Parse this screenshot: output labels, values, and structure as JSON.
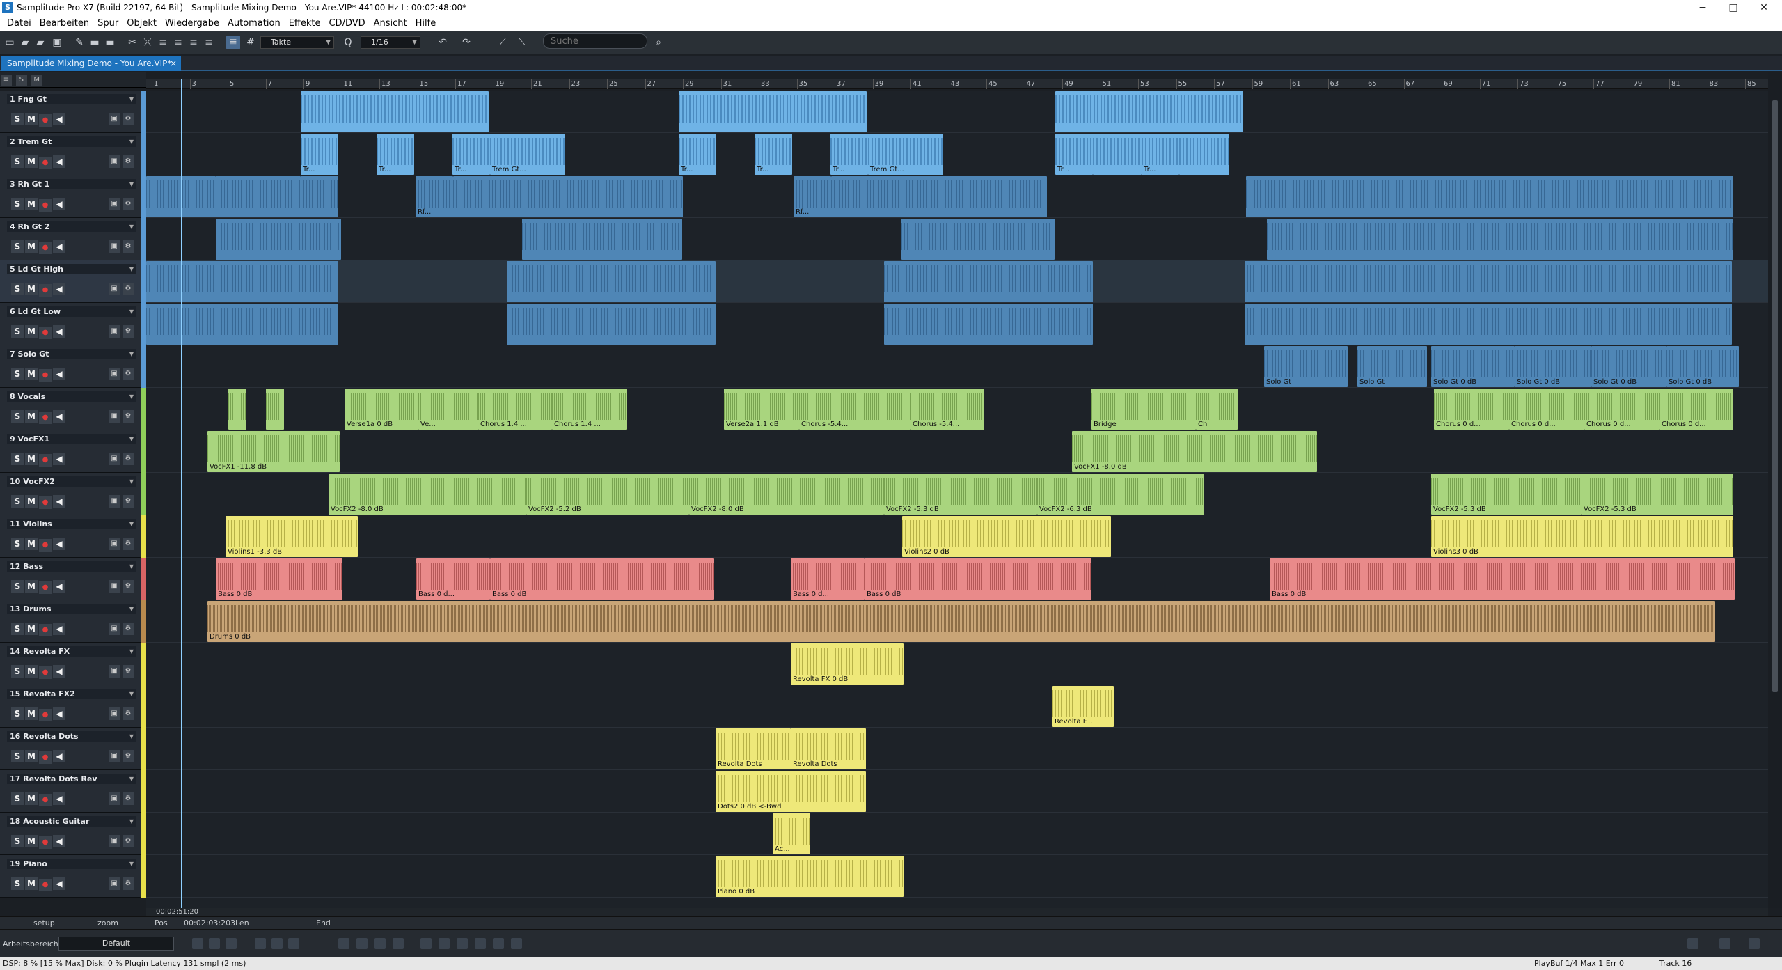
{
  "window": {
    "title": "Samplitude Pro X7 (Build 22197, 64 Bit)  -  Samplitude Mixing Demo - You Are.VIP*   44100 Hz L: 00:02:48:00*"
  },
  "menu": [
    "Datei",
    "Bearbeiten",
    "Spur",
    "Objekt",
    "Wiedergabe",
    "Automation",
    "Effekte",
    "CD/DVD",
    "Ansicht",
    "Hilfe"
  ],
  "toolbar": {
    "grid_mode": "Takte",
    "quantize_label": "Q",
    "quantize": "1/16",
    "search_placeholder": "Suche"
  },
  "project_tab": {
    "label": "Samplitude Mixing Demo - You Are.VIP*",
    "close": "×"
  },
  "header_buttons": [
    "S",
    "M"
  ],
  "ruler_ticks": [
    "1",
    "3",
    "5",
    "7",
    "9",
    "11",
    "13",
    "15",
    "17",
    "19",
    "21",
    "23",
    "25",
    "27",
    "29",
    "31",
    "33",
    "35",
    "37",
    "39",
    "41",
    "43",
    "45",
    "47",
    "49",
    "51",
    "53",
    "55",
    "57",
    "59",
    "61",
    "63",
    "65",
    "67",
    "69",
    "71",
    "73",
    "75",
    "77",
    "79",
    "81",
    "83",
    "85"
  ],
  "tracks": [
    {
      "num": "1",
      "name": "Fng Gt",
      "color": "#5b9bd5"
    },
    {
      "num": "2",
      "name": "Trem Gt",
      "color": "#5b9bd5"
    },
    {
      "num": "3",
      "name": "Rh Gt 1",
      "color": "#5b9bd5"
    },
    {
      "num": "4",
      "name": "Rh Gt 2",
      "color": "#5b9bd5"
    },
    {
      "num": "5",
      "name": "Ld Gt High",
      "color": "#5b9bd5"
    },
    {
      "num": "6",
      "name": "Ld Gt Low",
      "color": "#5b9bd5"
    },
    {
      "num": "7",
      "name": "Solo Gt",
      "color": "#5b9bd5"
    },
    {
      "num": "8",
      "name": "Vocals",
      "color": "#8fcf5a"
    },
    {
      "num": "9",
      "name": "VocFX1",
      "color": "#8fcf5a"
    },
    {
      "num": "10",
      "name": "VocFX2",
      "color": "#8fcf5a"
    },
    {
      "num": "11",
      "name": "Violins",
      "color": "#e8e04a"
    },
    {
      "num": "12",
      "name": "Bass",
      "color": "#d96464"
    },
    {
      "num": "13",
      "name": "Drums",
      "color": "#b88a4e"
    },
    {
      "num": "14",
      "name": "Revolta FX",
      "color": "#e8e04a"
    },
    {
      "num": "15",
      "name": "Revolta FX2",
      "color": "#e8e04a"
    },
    {
      "num": "16",
      "name": "Revolta Dots",
      "color": "#e8e04a"
    },
    {
      "num": "17",
      "name": "Revolta Dots Rev",
      "color": "#e8e04a"
    },
    {
      "num": "18",
      "name": "Acoustic Guitar",
      "color": "#e8e04a"
    },
    {
      "num": "19",
      "name": "Piano",
      "color": "#e8e04a"
    }
  ],
  "clip_labels": {
    "trem1": "Tr...",
    "trem2": "Tr...",
    "trem3": "Tr...",
    "trem4": "Trem Gt...",
    "trem5": "Tr...",
    "trem6": "Tr...",
    "trem7": "Tr...",
    "trem8": "Trem Gt...",
    "trem9": "Tr...",
    "trem10": "Tr...",
    "rh1": "Rf...",
    "rh2": "Rf...",
    "solo1": "Solo Gt",
    "solo2": "Solo Gt",
    "solo3": "Solo Gt  0 dB",
    "solo4": "Solo Gt  0 dB",
    "solo5": "Solo Gt  0 dB",
    "solo6": "Solo Gt  0 dB",
    "voc1": "Verse1a  0 dB",
    "voc2": "Ve...",
    "voc3": "Chorus  1.4 ...",
    "voc4": "Chorus  1.4 ...",
    "voc5": "Verse2a  1.1 dB",
    "voc6": "Chorus  -5.4...",
    "voc7": "Chorus  -5.4...",
    "voc8": "Bridge",
    "voc9": "Ch",
    "voc10": "Chorus  0 d...",
    "voc11": "Chorus  0 d...",
    "voc12": "Chorus  0 d...",
    "voc13": "Chorus  0 d...",
    "vfx1a": "VocFX1  -11.8 dB",
    "vfx1b": "VocFX1  -8.0 dB",
    "vfx2a": "VocFX2  -8.0 dB",
    "vfx2b": "VocFX2  -5.2 dB",
    "vfx2c": "VocFX2  -8.0 dB",
    "vfx2d": "VocFX2  -5.3 dB",
    "vfx2e": "VocFX2  -6.3 dB",
    "vfx2f": "VocFX2  -5.3 dB",
    "vfx2g": "VocFX2  -5.3 dB",
    "vio1": "Violins1  -3.3 dB",
    "vio2": "Violins2  0 dB",
    "vio3": "Violins3  0 dB",
    "bass1": "Bass  0 dB",
    "bass2": "Bass  0 d...",
    "bass3": "Bass  0 dB",
    "bass4": "Bass  0 d...",
    "bass5": "Bass  0 dB",
    "bass6": "Bass  0 dB",
    "drums": "Drums  0 dB",
    "rfx1": "Revolta FX  0 dB",
    "rfx2": "Revolta F...",
    "dots1": "Revolta Dots",
    "dots2": "Revolta Dots",
    "dotsrev": "Dots2  0 dB  <-Bwd",
    "ac": "Ac...",
    "piano": "Piano  0 dB"
  },
  "position_bar": {
    "position": "00:02:51:20"
  },
  "bottom": {
    "pos_label": "Pos",
    "pos_value": "00:02:03:203",
    "len_label": "Len",
    "end_label": "End",
    "setup": "setup",
    "zoom": "zoom",
    "workspace_label": "Arbeitsbereich:",
    "workspace_value": "Default"
  },
  "status": {
    "dsp": "DSP: 8 %   [15 % Max]   Disk:  0 %  Plugin Latency 131 smpl (2 ms)",
    "playbuf": "PlayBuf 1/4  Max 1  Err 0",
    "track": "Track 16"
  }
}
